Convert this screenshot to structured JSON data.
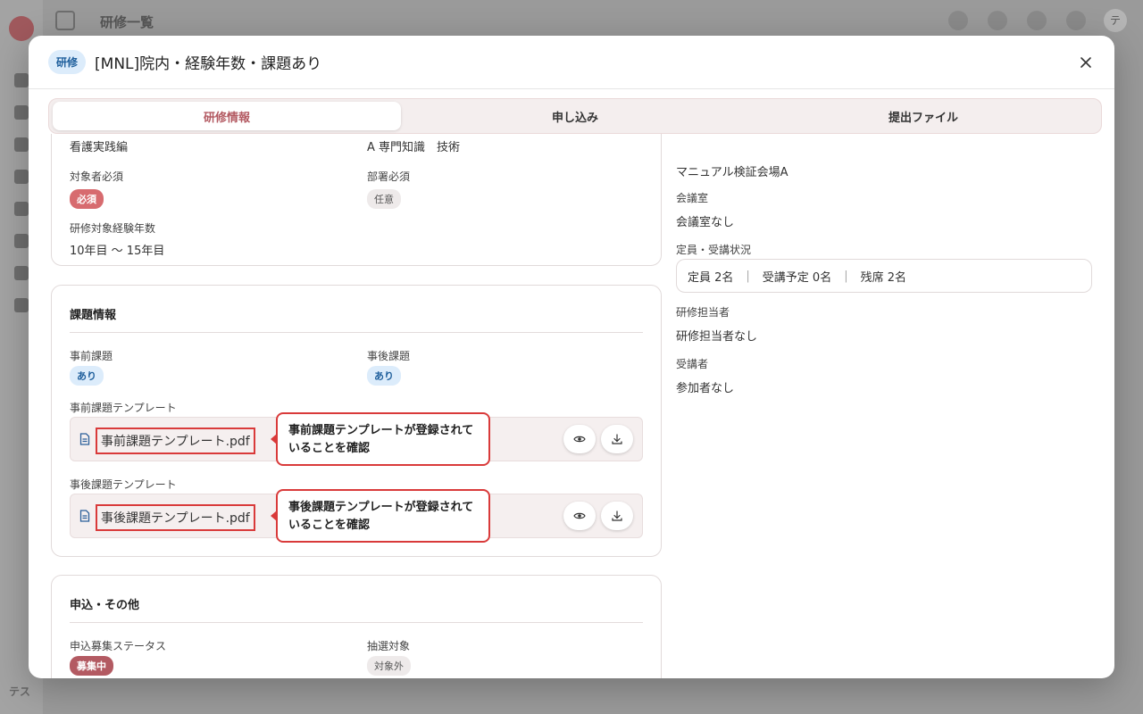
{
  "background": {
    "page_title": "研修一覧",
    "user_initial": "テ",
    "footer_initials": "テス"
  },
  "modal": {
    "type_badge": "研修",
    "title": "[MNL]院内・経験年数・課題あり"
  },
  "tabs": [
    {
      "label": "研修情報",
      "active": true
    },
    {
      "label": "申し込み",
      "active": false
    },
    {
      "label": "提出ファイル",
      "active": false
    }
  ],
  "overview": {
    "category_value": "看護実践編",
    "skill_value": "A 専門知識　技術",
    "target_required_label": "対象者必須",
    "target_required_value": "必須",
    "dept_required_label": "部署必須",
    "dept_required_value": "任意",
    "experience_label": "研修対象経験年数",
    "experience_value": "10年目 〜 15年目"
  },
  "assignment": {
    "title": "課題情報",
    "pre_label": "事前課題",
    "pre_value": "あり",
    "post_label": "事後課題",
    "post_value": "あり",
    "pre_template_label": "事前課題テンプレート",
    "pre_template_file": "事前課題テンプレート.pdf",
    "pre_callout_line1": "事前課題テンプレートが登録されて",
    "pre_callout_line2": "いることを確認",
    "post_template_label": "事後課題テンプレート",
    "post_template_file": "事後課題テンプレート.pdf",
    "post_callout_line1": "事後課題テンプレートが登録されて",
    "post_callout_line2": "いることを確認"
  },
  "application": {
    "title": "申込・その他",
    "status_label": "申込募集ステータス",
    "status_value": "募集中",
    "lottery_label": "抽選対象",
    "lottery_value": "対象外"
  },
  "right": {
    "venue_value": "マニュアル検証会場A",
    "room_label": "会議室",
    "room_value": "会議室なし",
    "capacity_label": "定員・受講状況",
    "capacity_total": "定員 2名",
    "capacity_planned": "受講予定 0名",
    "capacity_remaining": "残席 2名",
    "staff_label": "研修担当者",
    "staff_value": "研修担当者なし",
    "attendee_label": "受講者",
    "attendee_value": "参加者なし"
  },
  "colors": {
    "accent": "#b35a62",
    "callout_border": "#d93a3a",
    "badge_blue_bg": "#dcecfb"
  }
}
